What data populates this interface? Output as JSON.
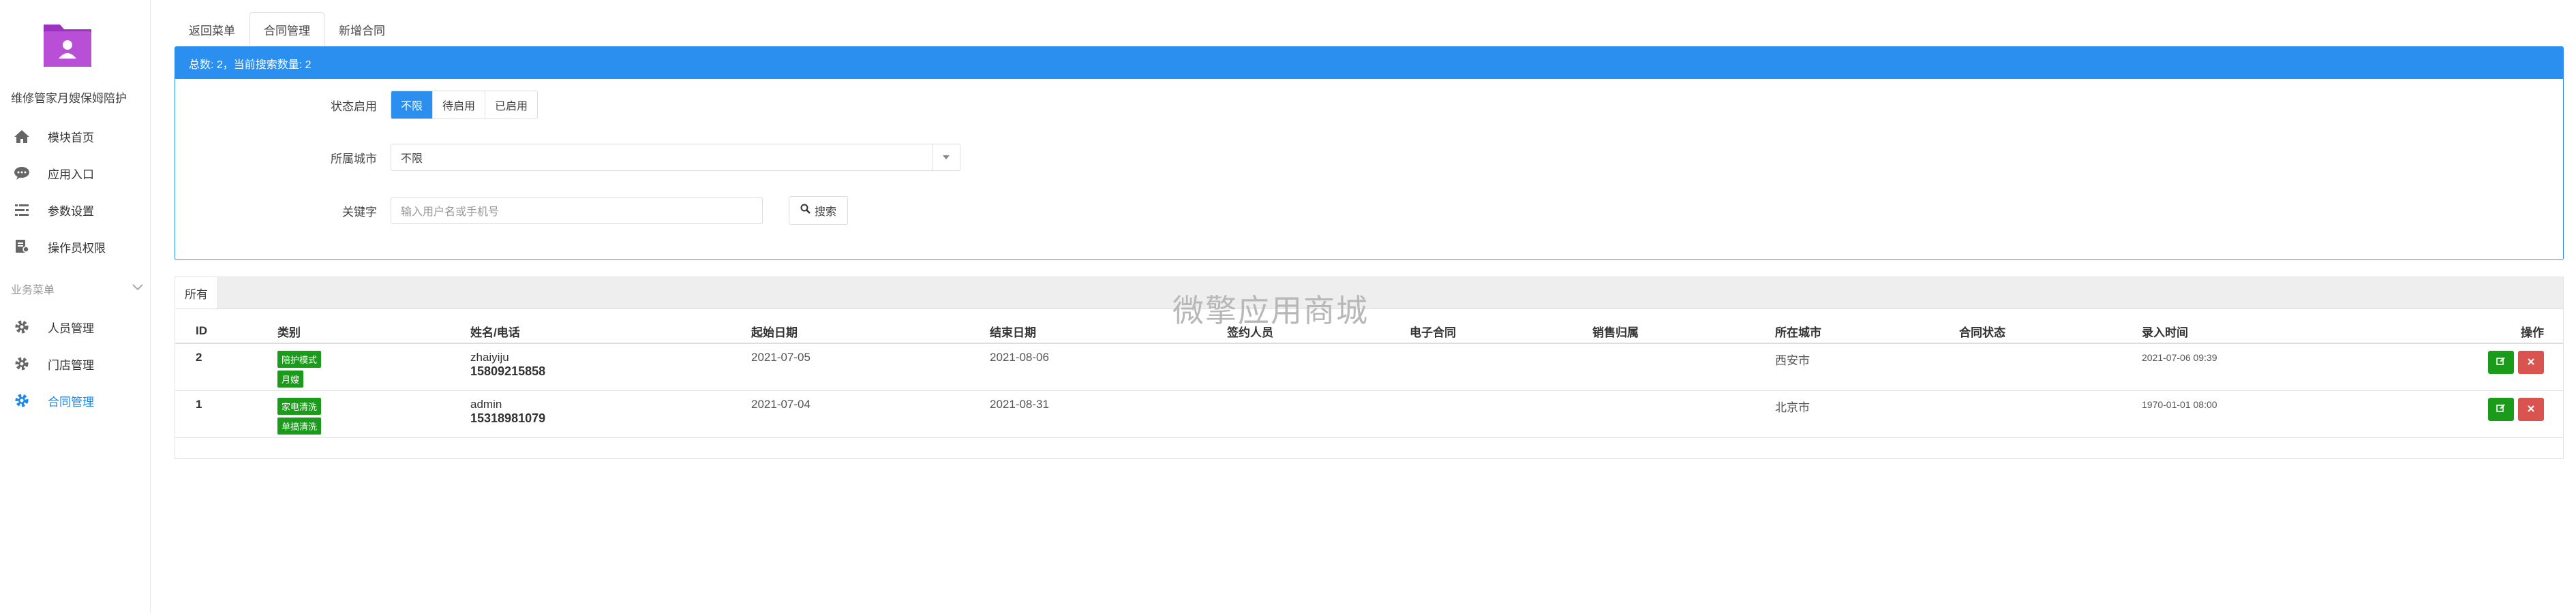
{
  "sidebar": {
    "brand": "维修管家月嫂保姆陪护",
    "items": [
      {
        "label": "模块首页",
        "icon": "home-icon"
      },
      {
        "label": "应用入口",
        "icon": "chat-icon"
      },
      {
        "label": "参数设置",
        "icon": "list-settings-icon"
      },
      {
        "label": "操作员权限",
        "icon": "permission-icon"
      }
    ],
    "group_title": "业务菜单",
    "group_items": [
      {
        "label": "人员管理",
        "icon": "gear-icon"
      },
      {
        "label": "门店管理",
        "icon": "gear-icon"
      },
      {
        "label": "合同管理",
        "icon": "gear-icon",
        "active": true
      }
    ]
  },
  "tabs": [
    {
      "label": "返回菜单"
    },
    {
      "label": "合同管理",
      "active": true
    },
    {
      "label": "新增合同"
    }
  ],
  "filter": {
    "header": "总数: 2，当前搜索数量: 2",
    "status_label": "状态启用",
    "status_options": [
      "不限",
      "待启用",
      "已启用"
    ],
    "status_selected": "不限",
    "city_label": "所属城市",
    "city_value": "不限",
    "keyword_label": "关键字",
    "keyword_placeholder": "输入用户名或手机号",
    "search_label": "搜索"
  },
  "list": {
    "tab": "所有",
    "watermark": "微擎应用商城",
    "columns": [
      "ID",
      "类别",
      "姓名/电话",
      "起始日期",
      "结束日期",
      "签约人员",
      "电子合同",
      "销售归属",
      "所在城市",
      "合同状态",
      "录入时间",
      "操作"
    ],
    "rows": [
      {
        "id": "2",
        "tags": [
          "陪护模式",
          "月嫂"
        ],
        "name": "zhaiyiju",
        "phone": "15809215858",
        "start": "2021-07-05",
        "end": "2021-08-06",
        "signer": "",
        "econtract": "",
        "sales": "",
        "city": "西安市",
        "status": "",
        "created": "2021-07-06 09:39"
      },
      {
        "id": "1",
        "tags": [
          "家电清洗",
          "单搞清洗"
        ],
        "name": "admin",
        "phone": "15318981079",
        "start": "2021-07-04",
        "end": "2021-08-31",
        "signer": "",
        "econtract": "",
        "sales": "",
        "city": "北京市",
        "status": "",
        "created": "1970-01-01 08:00"
      }
    ]
  },
  "colors": {
    "primary": "#2b8ff0",
    "success": "#1a9c1a",
    "danger": "#d9534f",
    "logo": "#b84fd6"
  }
}
